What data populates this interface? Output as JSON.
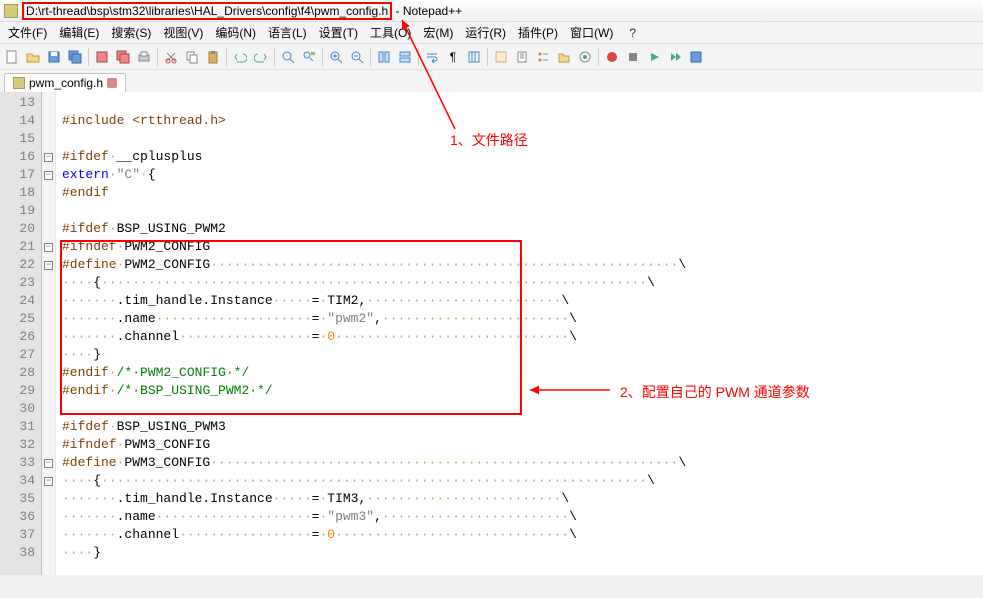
{
  "app_name": "Notepad++",
  "title_path": "D:\\rt-thread\\bsp\\stm32\\libraries\\HAL_Drivers\\config\\f4\\pwm_config.h",
  "menu": {
    "file": "文件(F)",
    "edit": "编辑(E)",
    "search": "搜索(S)",
    "view": "视图(V)",
    "encoding": "编码(N)",
    "lang": "语言(L)",
    "settings": "设置(T)",
    "tools": "工具(O)",
    "macro": "宏(M)",
    "run": "运行(R)",
    "plugins": "插件(P)",
    "window": "窗口(W)",
    "help": "?"
  },
  "tab": {
    "name": "pwm_config.h"
  },
  "gutter": [
    "13",
    "14",
    "15",
    "16",
    "17",
    "18",
    "19",
    "20",
    "21",
    "22",
    "23",
    "24",
    "25",
    "26",
    "27",
    "28",
    "29",
    "30",
    "31",
    "32",
    "33",
    "34",
    "35",
    "36",
    "37",
    "38"
  ],
  "fold": [
    "",
    "",
    "",
    "⊟",
    "⊟",
    "",
    "",
    "",
    "⊟",
    "⊟",
    "",
    "",
    "",
    "",
    "",
    "",
    "",
    "",
    "",
    "",
    "⊟",
    "⊟",
    "",
    "",
    "",
    "",
    "",
    ""
  ],
  "code": [
    {
      "t": ""
    },
    {
      "t": "#include <rtthread.h>",
      "cls": "pp",
      "dots": false
    },
    {
      "t": ""
    },
    {
      "html": "<span class='pp'>#ifdef</span><span class='ws'>·</span>__cplusplus"
    },
    {
      "html": "<span class='kw'>extern</span><span class='ws'>·</span><span class='str'>\"C\"</span><span class='ws'>·</span>{"
    },
    {
      "html": "<span class='pp'>#endif</span>"
    },
    {
      "t": ""
    },
    {
      "html": "<span class='pp'>#ifdef</span><span class='ws'>·</span>BSP_USING_PWM2"
    },
    {
      "html": "<span class='pp'>#ifndef</span><span class='ws'>·</span>PWM2_CONFIG"
    },
    {
      "html": "<span class='pp'>#define</span><span class='ws'>·</span>PWM2_CONFIG<span class='ws'>····························································</span>\\"
    },
    {
      "html": "<span class='ws'>····</span>{<span class='ws'>······································································</span>\\"
    },
    {
      "html": "<span class='ws'>·······</span>.tim_handle.Instance<span class='ws'>·····</span>=<span class='ws'>·</span>TIM2,<span class='ws'>·························</span>\\"
    },
    {
      "html": "<span class='ws'>·······</span>.name<span class='ws'>····················</span>=<span class='ws'>·</span><span class='str'>\"pwm2\"</span>,<span class='ws'>························</span>\\"
    },
    {
      "html": "<span class='ws'>·······</span>.channel<span class='ws'>·················</span>=<span class='ws'>·</span><span class='num'>0</span><span class='ws'>······························</span>\\"
    },
    {
      "html": "<span class='ws'>····</span>}"
    },
    {
      "html": "<span class='pp'>#endif</span><span class='ws'>·</span><span class='cmt'>/*·PWM2_CONFIG·*/</span>"
    },
    {
      "html": "<span class='pp'>#endif</span><span class='ws'>·</span><span class='cmt'>/*·BSP_USING_PWM2·*/</span>"
    },
    {
      "t": ""
    },
    {
      "html": "<span class='pp'>#ifdef</span><span class='ws'>·</span>BSP_USING_PWM3"
    },
    {
      "html": "<span class='pp'>#ifndef</span><span class='ws'>·</span>PWM3_CONFIG"
    },
    {
      "html": "<span class='pp'>#define</span><span class='ws'>·</span>PWM3_CONFIG<span class='ws'>····························································</span>\\"
    },
    {
      "html": "<span class='ws'>····</span>{<span class='ws'>······································································</span>\\"
    },
    {
      "html": "<span class='ws'>·······</span>.tim_handle.Instance<span class='ws'>·····</span>=<span class='ws'>·</span>TIM3,<span class='ws'>·························</span>\\"
    },
    {
      "html": "<span class='ws'>·······</span>.name<span class='ws'>····················</span>=<span class='ws'>·</span><span class='str'>\"pwm3\"</span>,<span class='ws'>························</span>\\"
    },
    {
      "html": "<span class='ws'>·······</span>.channel<span class='ws'>·················</span>=<span class='ws'>·</span><span class='num'>0</span><span class='ws'>······························</span>\\"
    },
    {
      "html": "<span class='ws'>····</span>}"
    }
  ],
  "annotations": {
    "a1": "1、文件路径",
    "a2": "2、配置自己的 PWM 通道参数"
  }
}
